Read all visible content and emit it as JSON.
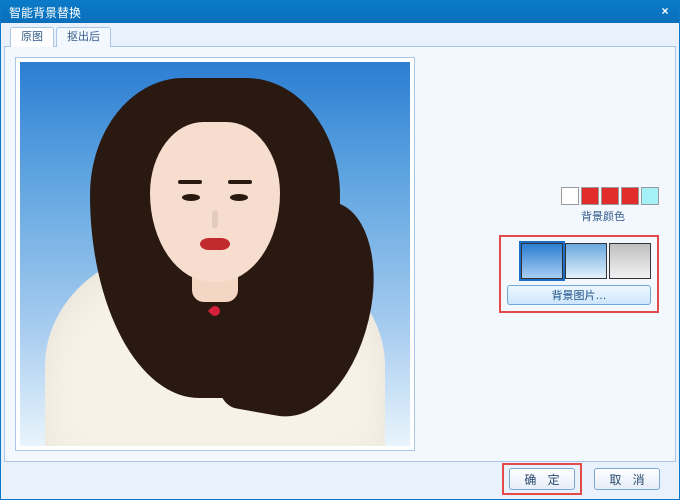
{
  "window": {
    "title": "智能背景替换",
    "close_glyph": "×"
  },
  "tabs": [
    {
      "label": "原图",
      "active": true
    },
    {
      "label": "抠出后",
      "active": false
    }
  ],
  "color_swatches": {
    "label": "背景颜色",
    "colors": [
      "#ffffff",
      "#e22b2b",
      "#e22b2b",
      "#e22b2b",
      "#a4f2f7"
    ]
  },
  "image_swatches": {
    "label": "背景图片…",
    "items": [
      {
        "gradient": "linear-gradient(180deg,#2b7ed3,#a8cdf0)",
        "selected": true
      },
      {
        "gradient": "linear-gradient(180deg,#6aa8df,#e4f1fb)",
        "selected": false
      },
      {
        "gradient": "linear-gradient(180deg,#bfbfbf,#f2f2f2)",
        "selected": false
      }
    ]
  },
  "buttons": {
    "ok": "确 定",
    "cancel": "取 消"
  },
  "highlight": {
    "ok_button": true,
    "image_swatch_group": true
  }
}
